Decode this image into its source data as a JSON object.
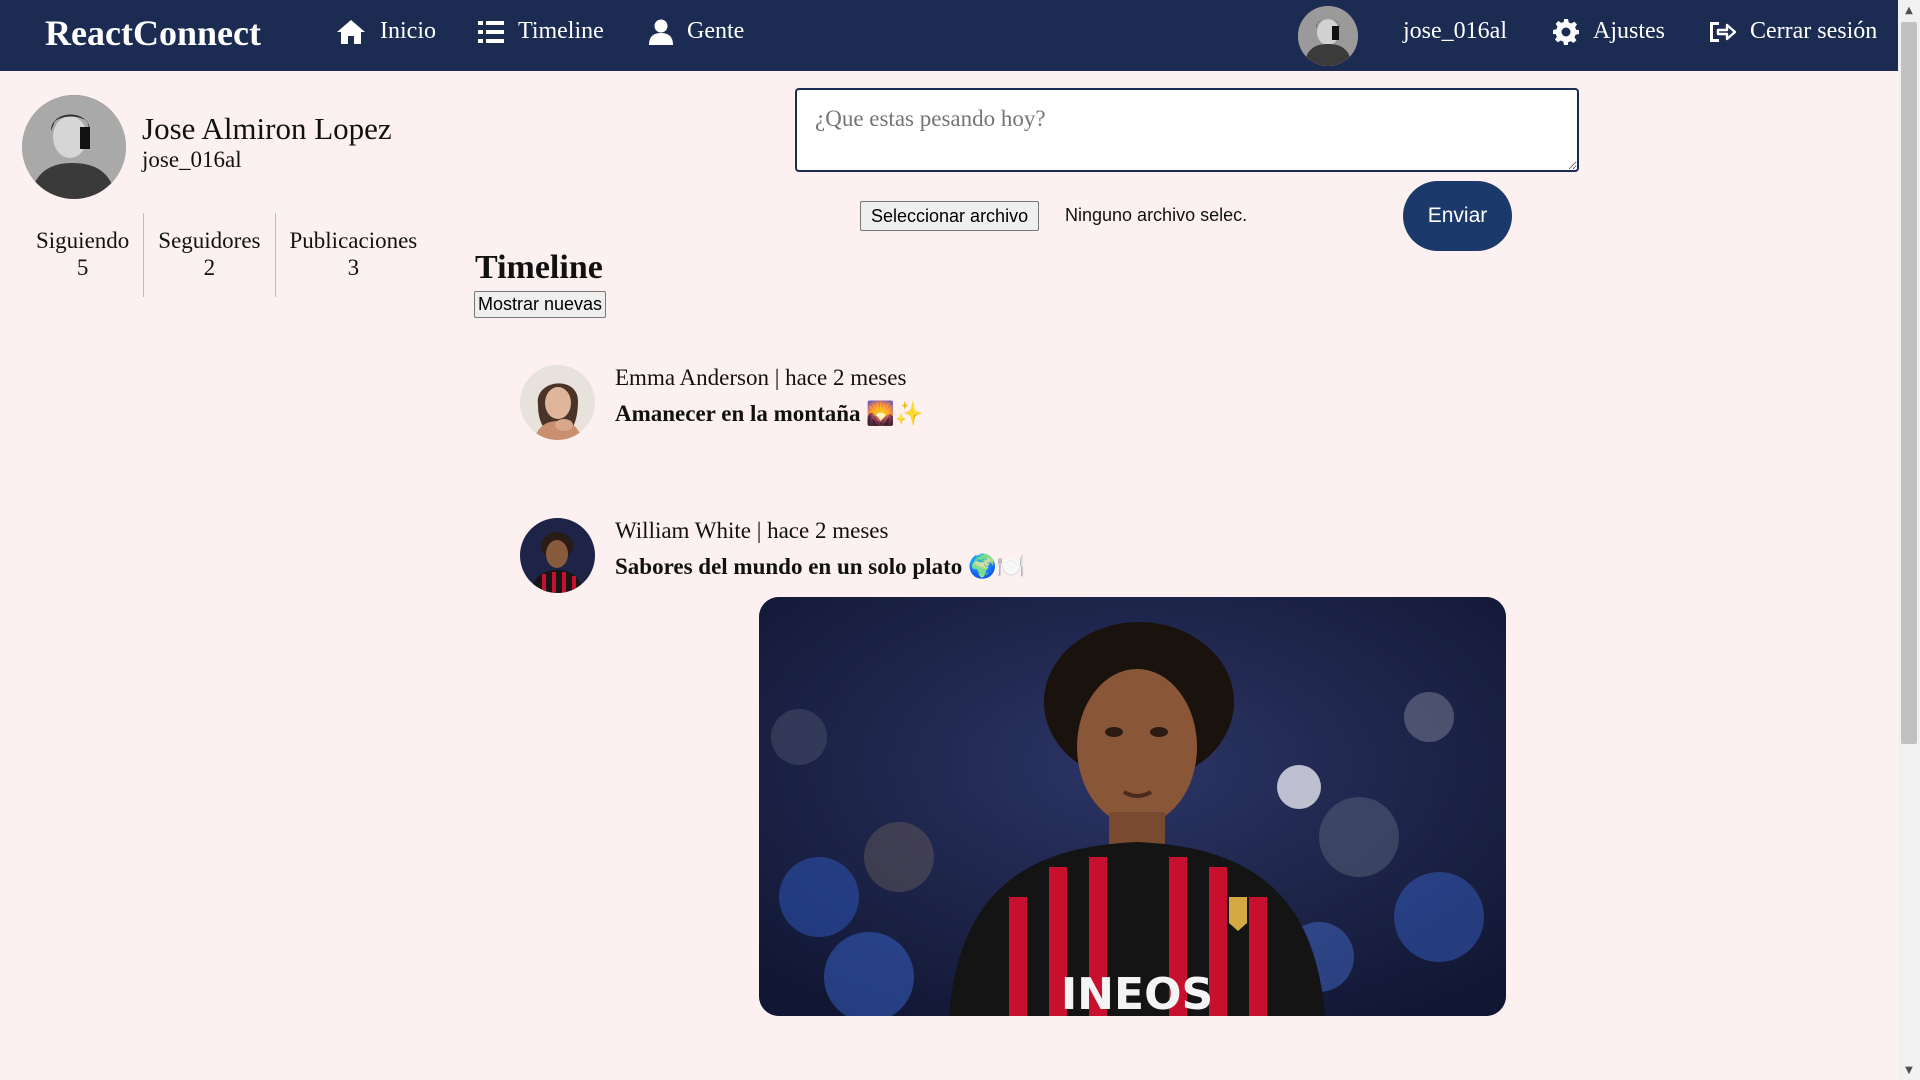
{
  "nav": {
    "brand": "ReactConnect",
    "links": [
      {
        "label": "Inicio",
        "icon": "home-icon"
      },
      {
        "label": "Timeline",
        "icon": "list-icon"
      },
      {
        "label": "Gente",
        "icon": "user-icon"
      }
    ],
    "username": "jose_016al",
    "settings_label": "Ajustes",
    "logout_label": "Cerrar sesión"
  },
  "profile": {
    "name": "Jose Almiron Lopez",
    "handle": "jose_016al",
    "stats": [
      {
        "label": "Siguiendo",
        "value": "5"
      },
      {
        "label": "Seguidores",
        "value": "2"
      },
      {
        "label": "Publicaciones",
        "value": "3"
      }
    ]
  },
  "composer": {
    "placeholder": "¿Que estas pesando hoy?",
    "file_button": "Seleccionar archivo",
    "file_status": "Ninguno archivo selec.",
    "send_label": "Enviar"
  },
  "timeline": {
    "title": "Timeline",
    "show_new_label": "Mostrar nuevas",
    "posts": [
      {
        "author": "Emma Anderson",
        "separator": "|",
        "time": "hace 2 meses",
        "text": "Amanecer en la montaña 🌄✨"
      },
      {
        "author": "William White",
        "separator": "|",
        "time": "hace 2 meses",
        "text": "Sabores del mundo en un solo plato 🌍🍽️"
      }
    ]
  },
  "colors": {
    "navbar": "#1b2b52",
    "background": "#fcf0f0",
    "send_button": "#1b3a6b"
  }
}
